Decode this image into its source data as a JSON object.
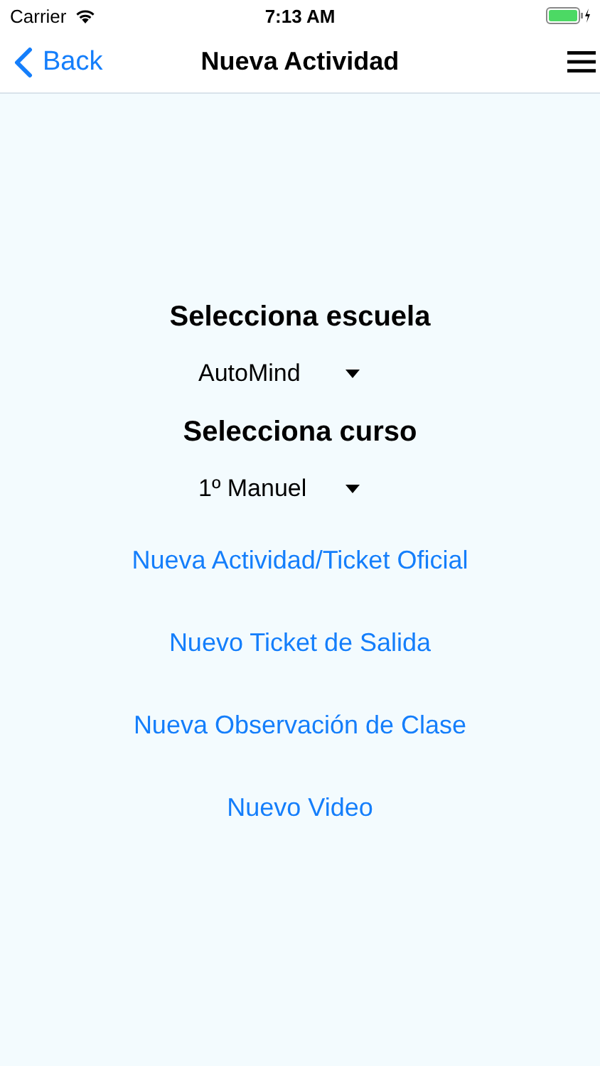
{
  "status_bar": {
    "carrier": "Carrier",
    "time": "7:13 AM"
  },
  "nav_bar": {
    "back": "Back",
    "title": "Nueva Actividad"
  },
  "sections": [
    {
      "heading": "Selecciona escuela",
      "dropdown": "AutoMind"
    },
    {
      "heading": "Selecciona curso",
      "dropdown": "1º Manuel"
    }
  ],
  "links": [
    "Nueva Actividad/Ticket Oficial",
    "Nuevo Ticket de Salida",
    "Nueva Observación de Clase",
    "Nuevo Video"
  ]
}
